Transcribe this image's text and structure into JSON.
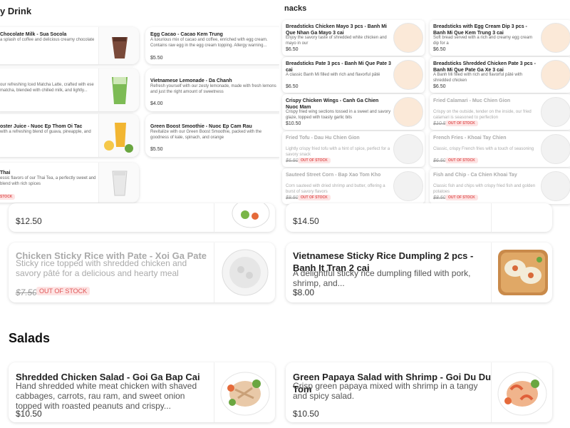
{
  "sections": {
    "drink_title": "y Drink",
    "snacks_title": "nacks",
    "salads_title": "Salads"
  },
  "drinks": [
    {
      "title": "Chocolate Milk - Sua Socola",
      "desc": "a splash of coffee and delicious creamy chocolate",
      "price": ""
    },
    {
      "title": "Egg Cacao - Cacao Kem Trung",
      "desc": "A luxurious mix of cacao and coffee, enriched with egg cream. Contains raw egg in the egg cream topping. Allergy warning...",
      "price": "$5.50"
    },
    {
      "title": "",
      "desc": "our refreshing Iced Matcha Latte, crafted with ese matcha, blended with chilled milk, and lightly...",
      "price": ""
    },
    {
      "title": "Vietnamese Lemonade - Da Chanh",
      "desc": "Refresh yourself with our zesty lemonade, made with fresh lemons and just the right amount of sweetness",
      "price": "$4.00"
    },
    {
      "title": "oster Juice - Nuoc Ep Thom Oi Tac",
      "desc": "with a refreshing blend of guava, pineapple, and",
      "price": ""
    },
    {
      "title": "Green Boost Smoothie - Nuoc Ep Cam Rau",
      "desc": "Revitalize with our Green Boost Smoothie, packed with the goodness of kale, spinach, and orange",
      "price": "$5.50"
    },
    {
      "title": "Thai",
      "desc": "essic flavors of our Thai Tea, a perfectly sweet and blend with rich spices",
      "price": "",
      "badge": "STOCK"
    }
  ],
  "snacks": [
    {
      "title": "Breadsticks Chicken Mayo 3 pcs - Banh Mi Que Nhan Ga Mayo 3 cai",
      "desc": "Enjoy the savory taste of shredded white chicken and mayo in our",
      "price": "$6.50"
    },
    {
      "title": "Breadsticks with Egg Cream Dip 3 pcs - Banh Mi Que Kem Trung 3 cai",
      "desc": "Soft bread served with a rich and creamy egg cream dip for a",
      "price": "$6.50"
    },
    {
      "title": "Breadsticks Pate 3 pcs - Banh Mi Que Pate 3 cai",
      "desc": "A classic Banh Mi filled with rich and flavorful pâté",
      "price": "$6.50"
    },
    {
      "title": "Breadsticks Shredded Chicken Pate 3 pcs - Banh Mi Que Pate Ga Xe 3 cai",
      "desc": "A Banh Mi filled with rich and flavorful pâté with shredded chicken",
      "price": "$6.50"
    },
    {
      "title": "Crispy Chicken Wings - Canh Ga Chien Nuoc Mam",
      "desc": "Crispy fried wing sections tossed in a sweet and savory glaze, topped with toasty garlic bits",
      "price": "$10.50"
    },
    {
      "title": "Fried Calamari - Muc Chien Gion",
      "desc": "Crispy on the outside, tender on the inside, our fried calamari is seasoned to perfection",
      "price": "$10.50",
      "badge": "OUT OF STOCK",
      "oos": true
    },
    {
      "title": "Fried Tofu - Dau Hu Chien Gion",
      "desc": "Lightly crispy fried tofu with a hint of spice, perfect for a savory snack",
      "price": "$6.50",
      "badge": "OUT OF STOCK",
      "oos": true
    },
    {
      "title": "French Fries - Khoai Tay Chien",
      "desc": "Classic, crispy French fries with a touch of seasoning",
      "price": "$6.50",
      "badge": "OUT OF STOCK",
      "oos": true
    },
    {
      "title": "Sauteed Street Corn - Bap Xao Tom Kho",
      "desc": "Corn sauteed with dried shrimp and butter, offering a burst of savory flavors",
      "price": "$8.50",
      "badge": "OUT OF STOCK",
      "oos": true
    },
    {
      "title": "Fish and Chip - Ca Chien Khoai Tay",
      "desc": "Classic fish and chips with crispy fried fish and golden potatoes",
      "price": "$8.50",
      "badge": "OUT OF STOCK",
      "oos": true
    }
  ],
  "partial_prices": {
    "left": "$12.50",
    "right": "$14.50"
  },
  "mains": [
    {
      "title": "Chicken Sticky Rice with Pate - Xoi Ga Pate",
      "desc": "Sticky rice topped with shredded chicken and savory pâté for a delicious and hearty meal",
      "price": "$7.50",
      "badge": "OUT OF STOCK",
      "oos": true
    },
    {
      "title": "Vietnamese Sticky Rice Dumpling 2 pcs - Banh It Tran 2 cai",
      "desc": "A delightful sticky rice dumpling filled with pork, shrimp, and...",
      "price": "$8.00"
    }
  ],
  "salads": [
    {
      "title": "Shredded Chicken Salad - Goi Ga Bap Cai",
      "desc": "Hand shredded white meat chicken with shaved cabbages, carrots, rau ram, and sweet onion topped with roasted peanuts and crispy...",
      "price": "$10.50"
    },
    {
      "title": "Green Papaya Salad with Shrimp - Goi Du Du Tom",
      "desc": "Crisp green papaya mixed with shrimp in a tangy and spicy salad.",
      "price": "$10.50"
    }
  ],
  "colors": {
    "accent_red": "#e05555",
    "oos_bg": "#fde4e4"
  }
}
